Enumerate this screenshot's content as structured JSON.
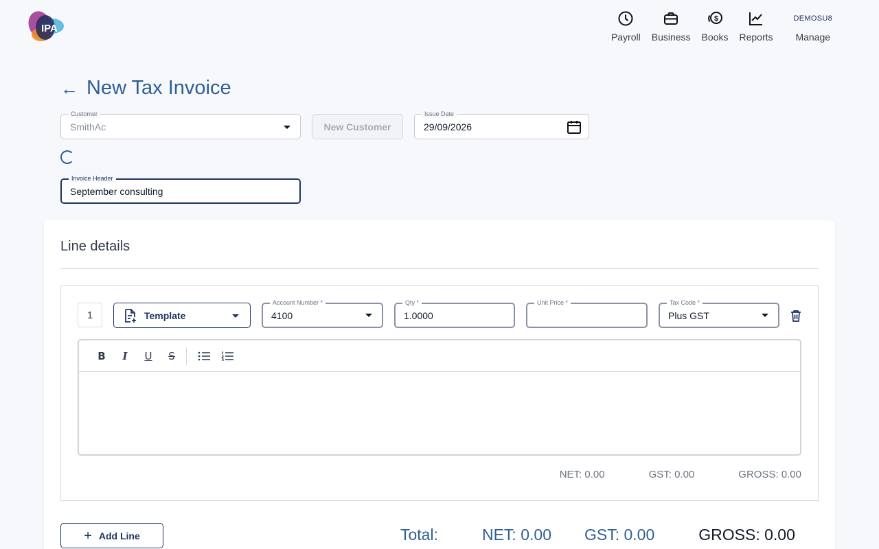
{
  "brand": {
    "logo_text": "IPA"
  },
  "nav": {
    "items": [
      {
        "label": "Payroll",
        "icon": "clock-icon"
      },
      {
        "label": "Business",
        "icon": "briefcase-icon"
      },
      {
        "label": "Books",
        "icon": "dollar-coins-icon"
      },
      {
        "label": "Reports",
        "icon": "chart-line-icon"
      }
    ],
    "company_code": "DEMOSU8",
    "manage_label": "Manage"
  },
  "page": {
    "title": "New Tax Invoice",
    "back_icon": "arrow-left-icon"
  },
  "form": {
    "customer": {
      "label": "Customer",
      "value": "SmithAc"
    },
    "new_customer_label": "New Customer",
    "issue_date": {
      "label": "Issue Date",
      "value": "29/09/2026"
    },
    "invoice_header": {
      "label": "Invoice Header",
      "value": "September consulting"
    }
  },
  "line_details": {
    "title": "Line details",
    "lines": [
      {
        "number": "1",
        "template_label": "Template",
        "account_number": {
          "label": "Account Number *",
          "value": "4100"
        },
        "qty": {
          "label": "Qty *",
          "value": "1.0000"
        },
        "unit_price": {
          "label": "Unit Price *",
          "value": ""
        },
        "tax_code": {
          "label": "Tax Code *",
          "value": "Plus GST"
        },
        "editor_tools": [
          "bold",
          "italic",
          "underline",
          "strikethrough",
          "bullet-list",
          "numbered-list"
        ],
        "net": "NET: 0.00",
        "gst": "GST: 0.00",
        "gross": "GROSS: 0.00"
      }
    ],
    "add_line_label": "Add Line",
    "totals": {
      "label": "Total:",
      "net": "NET: 0.00",
      "gst": "GST: 0.00",
      "gross": "GROSS: 0.00"
    }
  },
  "colors": {
    "accent": "#2e5f95",
    "navy": "#1e3462",
    "background": "#f6f8fb"
  }
}
